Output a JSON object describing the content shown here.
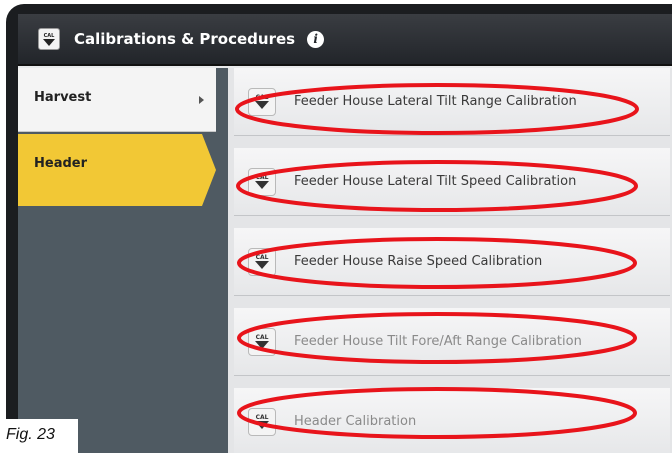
{
  "window": {
    "title": "Calibrations & Procedures",
    "title_icon": "cal-icon",
    "info_icon": "info-icon"
  },
  "sidebar": {
    "items": [
      {
        "label": "Harvest",
        "has_submenu": true,
        "selected": false
      },
      {
        "label": "Header",
        "has_submenu": false,
        "selected": true
      }
    ]
  },
  "procedures": {
    "icon_text": "CAL",
    "items": [
      {
        "label": "Feeder House Lateral Tilt Range Calibration",
        "highlighted": true
      },
      {
        "label": "Feeder House Lateral Tilt Speed Calibration",
        "highlighted": true
      },
      {
        "label": "Feeder House Raise Speed Calibration",
        "highlighted": true
      },
      {
        "label": "Feeder House Tilt Fore/Aft Range Calibration",
        "highlighted": true
      },
      {
        "label": "Header Calibration",
        "highlighted": true
      }
    ]
  },
  "annotation_color": "#e8141b",
  "selected_color": "#f2c835",
  "caption": "Fig. 23"
}
